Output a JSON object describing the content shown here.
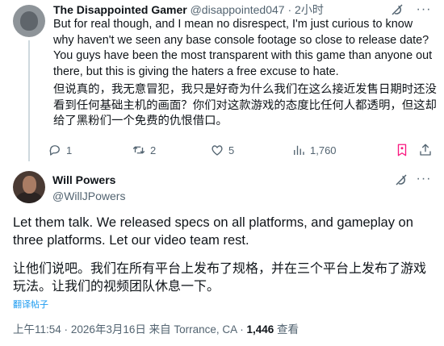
{
  "reply": {
    "name": "The Disappointed Gamer",
    "handle": "@disappointed047",
    "separator": "·",
    "time": "2小时",
    "text": "But for real though, and I mean no disrespect, I'm just curious to know why haven't we seen any base console footage so close to release date? You guys have been the most transparent with this game than anyone out there, but this is giving the haters a free excuse to hate.",
    "translation": "但说真的，我无意冒犯，我只是好奇为什么我们在这么接近发售日期时还没看到任何基础主机的画面？你们对这款游戏的态度比任何人都透明，但这却给了黑粉们一个免费的仇恨借口。",
    "actions": {
      "replies": "1",
      "reposts": "2",
      "likes": "5",
      "views": "1,760"
    }
  },
  "main": {
    "name": "Will Powers",
    "handle": "@WillJPowers",
    "text": "Let them talk. We released specs on all platforms, and gameplay on three platforms. Let our video team rest.",
    "translation": "让他们说吧。我们在所有平台上发布了规格，并在三个平台上发布了游戏玩法。让我们的视频团队休息一下。",
    "translate_link": "翻译帖子",
    "time": "上午11:54",
    "dot": "·",
    "date": "2026年3月16日",
    "source": "来自 Torrance, CA",
    "views_count": "1,446",
    "views_label": "查看"
  },
  "colors": {
    "text": "#0f1419",
    "muted": "#536471",
    "link": "#1d9bf0",
    "thread_line": "#cfd9de"
  }
}
